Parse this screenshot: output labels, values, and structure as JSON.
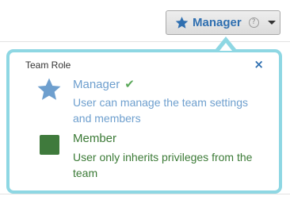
{
  "role_button": {
    "label": "Manager",
    "icon": "star-icon",
    "help_icon": "?",
    "dropdown_icon": "caret-down-icon"
  },
  "popover": {
    "title": "Team Role",
    "close_glyph": "×",
    "options": [
      {
        "name": "Manager",
        "description": "User can manage the team settings and members",
        "selected": true,
        "icon": "star-icon",
        "color": "#6e9fce"
      },
      {
        "name": "Member",
        "description": "User only inherits privileges from the team",
        "selected": false,
        "icon": "square-icon",
        "color": "#3b7a36"
      }
    ]
  },
  "colors": {
    "accent": "#2f6fb0",
    "popover_border": "#8ed7e3",
    "check": "#5ca95b"
  }
}
